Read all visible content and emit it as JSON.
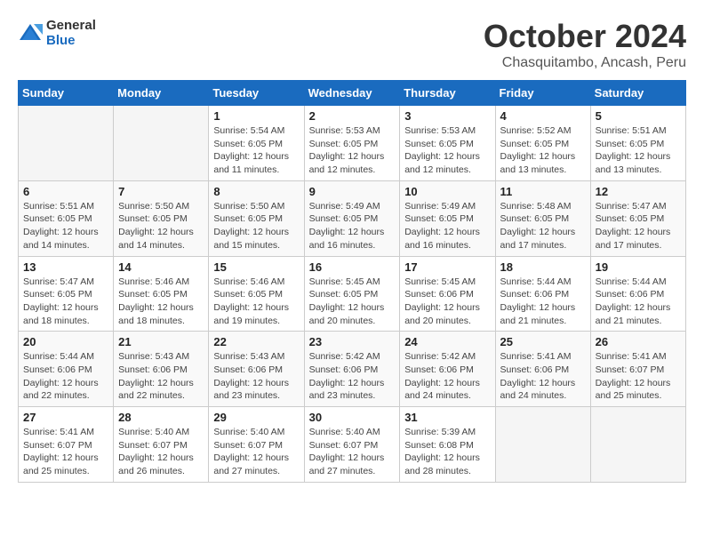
{
  "header": {
    "logo": {
      "general": "General",
      "blue": "Blue"
    },
    "title": "October 2024",
    "location": "Chasquitambo, Ancash, Peru"
  },
  "calendar": {
    "weekdays": [
      "Sunday",
      "Monday",
      "Tuesday",
      "Wednesday",
      "Thursday",
      "Friday",
      "Saturday"
    ],
    "weeks": [
      [
        {
          "day": "",
          "info": ""
        },
        {
          "day": "",
          "info": ""
        },
        {
          "day": "1",
          "info": "Sunrise: 5:54 AM\nSunset: 6:05 PM\nDaylight: 12 hours and 11 minutes."
        },
        {
          "day": "2",
          "info": "Sunrise: 5:53 AM\nSunset: 6:05 PM\nDaylight: 12 hours and 12 minutes."
        },
        {
          "day": "3",
          "info": "Sunrise: 5:53 AM\nSunset: 6:05 PM\nDaylight: 12 hours and 12 minutes."
        },
        {
          "day": "4",
          "info": "Sunrise: 5:52 AM\nSunset: 6:05 PM\nDaylight: 12 hours and 13 minutes."
        },
        {
          "day": "5",
          "info": "Sunrise: 5:51 AM\nSunset: 6:05 PM\nDaylight: 12 hours and 13 minutes."
        }
      ],
      [
        {
          "day": "6",
          "info": "Sunrise: 5:51 AM\nSunset: 6:05 PM\nDaylight: 12 hours and 14 minutes."
        },
        {
          "day": "7",
          "info": "Sunrise: 5:50 AM\nSunset: 6:05 PM\nDaylight: 12 hours and 14 minutes."
        },
        {
          "day": "8",
          "info": "Sunrise: 5:50 AM\nSunset: 6:05 PM\nDaylight: 12 hours and 15 minutes."
        },
        {
          "day": "9",
          "info": "Sunrise: 5:49 AM\nSunset: 6:05 PM\nDaylight: 12 hours and 16 minutes."
        },
        {
          "day": "10",
          "info": "Sunrise: 5:49 AM\nSunset: 6:05 PM\nDaylight: 12 hours and 16 minutes."
        },
        {
          "day": "11",
          "info": "Sunrise: 5:48 AM\nSunset: 6:05 PM\nDaylight: 12 hours and 17 minutes."
        },
        {
          "day": "12",
          "info": "Sunrise: 5:47 AM\nSunset: 6:05 PM\nDaylight: 12 hours and 17 minutes."
        }
      ],
      [
        {
          "day": "13",
          "info": "Sunrise: 5:47 AM\nSunset: 6:05 PM\nDaylight: 12 hours and 18 minutes."
        },
        {
          "day": "14",
          "info": "Sunrise: 5:46 AM\nSunset: 6:05 PM\nDaylight: 12 hours and 18 minutes."
        },
        {
          "day": "15",
          "info": "Sunrise: 5:46 AM\nSunset: 6:05 PM\nDaylight: 12 hours and 19 minutes."
        },
        {
          "day": "16",
          "info": "Sunrise: 5:45 AM\nSunset: 6:05 PM\nDaylight: 12 hours and 20 minutes."
        },
        {
          "day": "17",
          "info": "Sunrise: 5:45 AM\nSunset: 6:06 PM\nDaylight: 12 hours and 20 minutes."
        },
        {
          "day": "18",
          "info": "Sunrise: 5:44 AM\nSunset: 6:06 PM\nDaylight: 12 hours and 21 minutes."
        },
        {
          "day": "19",
          "info": "Sunrise: 5:44 AM\nSunset: 6:06 PM\nDaylight: 12 hours and 21 minutes."
        }
      ],
      [
        {
          "day": "20",
          "info": "Sunrise: 5:44 AM\nSunset: 6:06 PM\nDaylight: 12 hours and 22 minutes."
        },
        {
          "day": "21",
          "info": "Sunrise: 5:43 AM\nSunset: 6:06 PM\nDaylight: 12 hours and 22 minutes."
        },
        {
          "day": "22",
          "info": "Sunrise: 5:43 AM\nSunset: 6:06 PM\nDaylight: 12 hours and 23 minutes."
        },
        {
          "day": "23",
          "info": "Sunrise: 5:42 AM\nSunset: 6:06 PM\nDaylight: 12 hours and 23 minutes."
        },
        {
          "day": "24",
          "info": "Sunrise: 5:42 AM\nSunset: 6:06 PM\nDaylight: 12 hours and 24 minutes."
        },
        {
          "day": "25",
          "info": "Sunrise: 5:41 AM\nSunset: 6:06 PM\nDaylight: 12 hours and 24 minutes."
        },
        {
          "day": "26",
          "info": "Sunrise: 5:41 AM\nSunset: 6:07 PM\nDaylight: 12 hours and 25 minutes."
        }
      ],
      [
        {
          "day": "27",
          "info": "Sunrise: 5:41 AM\nSunset: 6:07 PM\nDaylight: 12 hours and 25 minutes."
        },
        {
          "day": "28",
          "info": "Sunrise: 5:40 AM\nSunset: 6:07 PM\nDaylight: 12 hours and 26 minutes."
        },
        {
          "day": "29",
          "info": "Sunrise: 5:40 AM\nSunset: 6:07 PM\nDaylight: 12 hours and 27 minutes."
        },
        {
          "day": "30",
          "info": "Sunrise: 5:40 AM\nSunset: 6:07 PM\nDaylight: 12 hours and 27 minutes."
        },
        {
          "day": "31",
          "info": "Sunrise: 5:39 AM\nSunset: 6:08 PM\nDaylight: 12 hours and 28 minutes."
        },
        {
          "day": "",
          "info": ""
        },
        {
          "day": "",
          "info": ""
        }
      ]
    ]
  }
}
